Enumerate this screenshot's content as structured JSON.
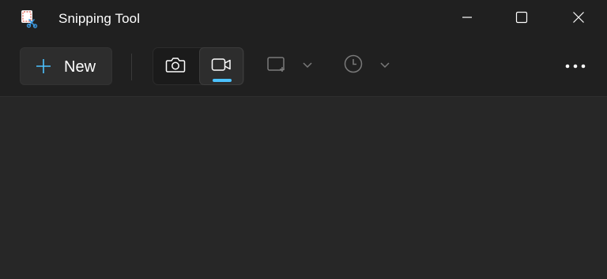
{
  "window": {
    "title": "Snipping Tool",
    "app_icon": "snipping-tool-icon",
    "controls": [
      "minimize-icon",
      "maximize-icon",
      "close-icon"
    ]
  },
  "toolbar": {
    "new_label": "New",
    "new_icon": "plus-icon",
    "modes": [
      {
        "icon": "camera-icon",
        "selected": false
      },
      {
        "icon": "video-camera-icon",
        "selected": true
      }
    ],
    "snip_shape_icon": "rectangle-snip-icon",
    "delay_icon": "clock-icon",
    "more_icon": "more-dots-icon"
  },
  "colors": {
    "accent": "#4cc2ff",
    "background": "#202020",
    "canvas": "#272727"
  }
}
